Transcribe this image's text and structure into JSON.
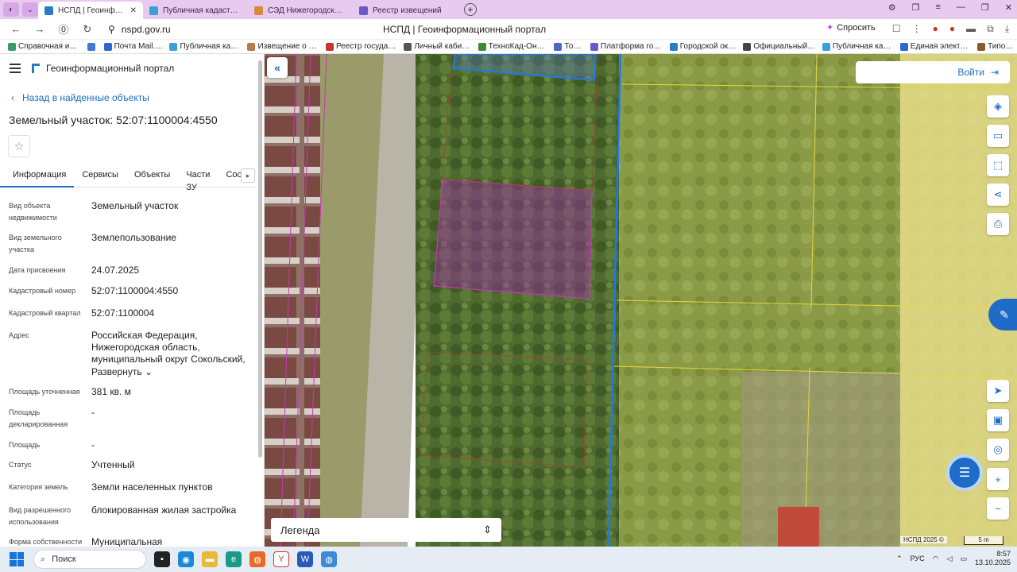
{
  "browser": {
    "tabs": [
      {
        "label": "НСПД | Геоинформацио",
        "active": true,
        "color": "#2a7ac8"
      },
      {
        "label": "Публичная кадастровая к",
        "active": false,
        "color": "#3aa0d8"
      },
      {
        "label": "СЭД Нижегородская обл",
        "active": false,
        "color": "#d88a3a"
      },
      {
        "label": "Реестр извещений",
        "active": false,
        "color": "#6a5ac8"
      }
    ],
    "url": "nspd.gov.ru",
    "page_title": "НСПД | Геоинформационный портал",
    "ask_label": "Спросить",
    "bookmarks": [
      "Справочная инфо",
      "",
      "Почта Mail.Ru",
      "Публичная кадас",
      "Извещение о про",
      "Реестр государст",
      "Личный кабинет",
      "ТехноКад-Онлай",
      "Торги",
      "Платформа госуд",
      "Городской округ",
      "Официальный по",
      "Публичная кадас",
      "Единая электрон",
      "Типовой"
    ]
  },
  "app": {
    "portal_name": "Геоинформационный портал",
    "back_label": "Назад в найденные объекты",
    "object_title": "Земельный участок: 52:07:1100004:4550",
    "tabs": [
      "Информация",
      "Сервисы",
      "Объекты",
      "Части ЗУ",
      "Соста"
    ],
    "expand_label": "Развернуть",
    "fields": [
      {
        "key": "Вид объекта недвижимости",
        "value": "Земельный участок"
      },
      {
        "key": "Вид земельного участка",
        "value": "Землепользование"
      },
      {
        "key": "Дата присвоения",
        "value": "24.07.2025"
      },
      {
        "key": "Кадастровый номер",
        "value": "52:07:1100004:4550"
      },
      {
        "key": "Кадастровый квартал",
        "value": "52:07:1100004"
      },
      {
        "key": "Адрес",
        "value": "Российская Федерация, Нижегородская область, муниципальный округ Сокольский,"
      },
      {
        "key": "Площадь уточненная",
        "value": "381 кв. м"
      },
      {
        "key": "Площадь декларированная",
        "value": "-"
      },
      {
        "key": "Площадь",
        "value": "-"
      },
      {
        "key": "Статус",
        "value": "Учтенный"
      },
      {
        "key": "Категория земель",
        "value": "Земли населенных пунктов"
      },
      {
        "key": "Вид разрешенного использования",
        "value": "блокированная жилая застройка"
      },
      {
        "key": "Форма собственности",
        "value": "Муниципальная"
      }
    ]
  },
  "map": {
    "login_label": "Войти",
    "legend_label": "Легенда",
    "attribution": "НСПД 2025 ©",
    "scale_label": "5 m",
    "colors": {
      "selected_parcel": "#9b2aa8",
      "boundary": "#1e7ae6",
      "quarter": "#e6d83a"
    }
  },
  "taskbar": {
    "search_placeholder": "Поиск",
    "lang": "РУС",
    "time": "8:57",
    "date": "13.10.2025"
  }
}
